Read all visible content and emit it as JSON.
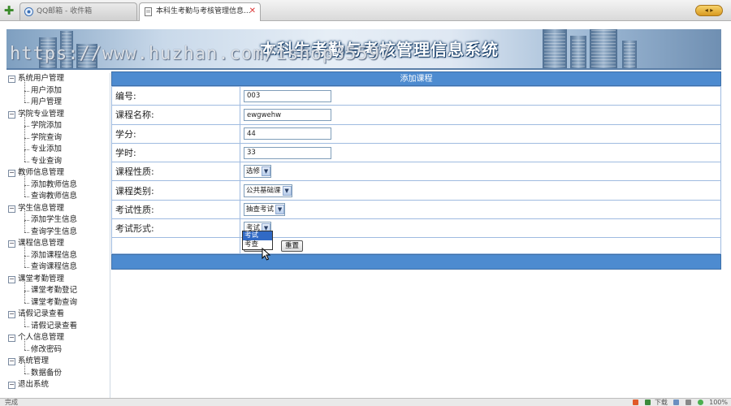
{
  "browser": {
    "tabs": [
      {
        "label": "QQ邮箱 - 收件箱",
        "active": false
      },
      {
        "label": "本科生考勤与考核管理信息...",
        "active": true
      }
    ],
    "status_left": "完成",
    "status_download": "下载",
    "status_zoom": "100%"
  },
  "banner": {
    "title": "本科生考勤与考核管理信息系统",
    "watermark": "https://www.huzhan.com/ishop35597"
  },
  "sidebar": {
    "groups": [
      {
        "title": "系统用户管理",
        "items": [
          "用户添加",
          "用户管理"
        ]
      },
      {
        "title": "学院专业管理",
        "items": [
          "学院添加",
          "学院查询",
          "专业添加",
          "专业查询"
        ]
      },
      {
        "title": "教师信息管理",
        "items": [
          "添加教师信息",
          "查询教师信息"
        ]
      },
      {
        "title": "学生信息管理",
        "items": [
          "添加学生信息",
          "查询学生信息"
        ]
      },
      {
        "title": "课程信息管理",
        "items": [
          "添加课程信息",
          "查询课程信息"
        ]
      },
      {
        "title": "课堂考勤管理",
        "items": [
          "课堂考勤登记",
          "课堂考勤查询"
        ]
      },
      {
        "title": "请假记录查看",
        "items": [
          "请假记录查看"
        ]
      },
      {
        "title": "个人信息管理",
        "items": [
          "修改密码"
        ]
      },
      {
        "title": "系统管理",
        "items": [
          "数据备份"
        ]
      },
      {
        "title": "退出系统",
        "items": []
      }
    ]
  },
  "form": {
    "title": "添加课程",
    "fields": {
      "code": {
        "label": "编号:",
        "value": "003"
      },
      "name": {
        "label": "课程名称:",
        "value": "ewgwehw"
      },
      "credit": {
        "label": "学分:",
        "value": "44"
      },
      "hours": {
        "label": "学时:",
        "value": "33"
      },
      "nature": {
        "label": "课程性质:",
        "value": "选修"
      },
      "category": {
        "label": "课程类别:",
        "value": "公共基础课"
      },
      "exam_nature": {
        "label": "考试性质:",
        "value": "抽查考试"
      },
      "exam_form": {
        "label": "考试形式:",
        "value": "考试"
      }
    },
    "exam_form_options": [
      "考试",
      "考查"
    ],
    "submit_label": "提交",
    "reset_label": "重置"
  }
}
